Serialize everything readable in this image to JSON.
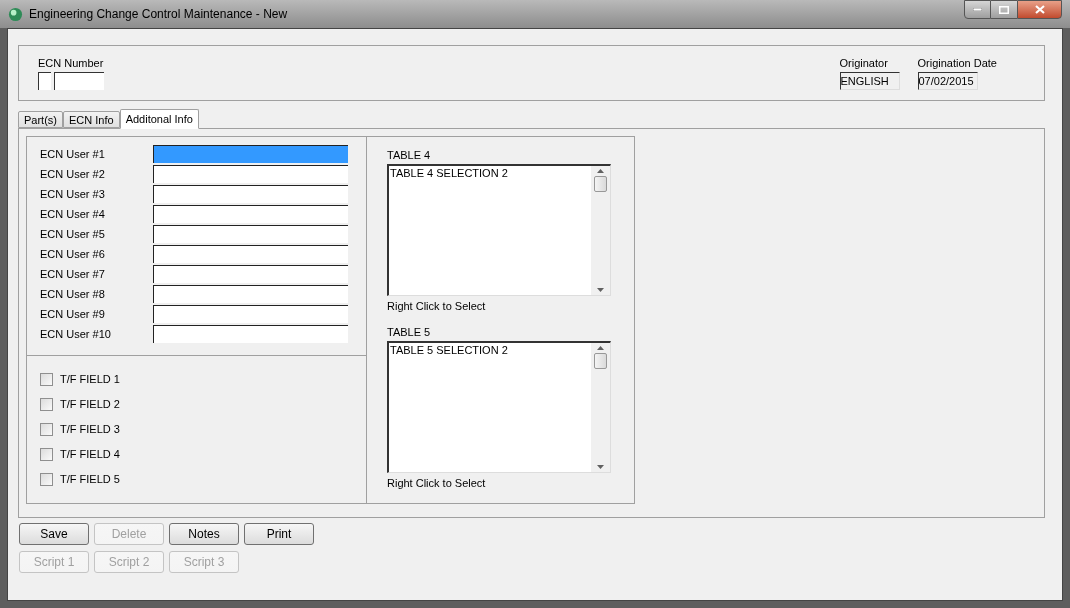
{
  "window": {
    "title": "Engineering Change Control Maintenance - New"
  },
  "header": {
    "ecn_number": {
      "label": "ECN Number"
    },
    "originator": {
      "label": "Originator",
      "value": "ENGLISH"
    },
    "origination_date": {
      "label": "Origination Date",
      "value": "07/02/2015"
    }
  },
  "tabs": [
    {
      "label": "Part(s)",
      "selected": false
    },
    {
      "label": "ECN Info",
      "selected": false
    },
    {
      "label": "Additonal Info",
      "selected": true
    }
  ],
  "user_fields": [
    {
      "label": "ECN User #1",
      "selected": true
    },
    {
      "label": "ECN User #2",
      "selected": false
    },
    {
      "label": "ECN User #3",
      "selected": false
    },
    {
      "label": "ECN User #4",
      "selected": false
    },
    {
      "label": "ECN User #5",
      "selected": false
    },
    {
      "label": "ECN User #6",
      "selected": false
    },
    {
      "label": "ECN User #7",
      "selected": false
    },
    {
      "label": "ECN User #8",
      "selected": false
    },
    {
      "label": "ECN User #9",
      "selected": false
    },
    {
      "label": "ECN User #10",
      "selected": false
    }
  ],
  "checkboxes": [
    {
      "label": "T/F FIELD 1",
      "checked": false
    },
    {
      "label": "T/F FIELD 2",
      "checked": false
    },
    {
      "label": "T/F FIELD 3",
      "checked": false
    },
    {
      "label": "T/F FIELD 4",
      "checked": false
    },
    {
      "label": "T/F FIELD 5",
      "checked": false
    }
  ],
  "tables": [
    {
      "title": "TABLE 4",
      "items": [
        "TABLE 4 SELECTION 2"
      ],
      "hint": "Right Click to Select"
    },
    {
      "title": "TABLE 5",
      "items": [
        "TABLE 5 SELECTION 2"
      ],
      "hint": "Right Click to Select"
    }
  ],
  "buttons": [
    {
      "label": "Save",
      "disabled": false
    },
    {
      "label": "Delete",
      "disabled": true
    },
    {
      "label": "Notes",
      "disabled": false
    },
    {
      "label": "Print",
      "disabled": false
    }
  ],
  "script_buttons": [
    {
      "label": "Script 1",
      "disabled": true
    },
    {
      "label": "Script 2",
      "disabled": true
    },
    {
      "label": "Script 3",
      "disabled": true
    }
  ]
}
